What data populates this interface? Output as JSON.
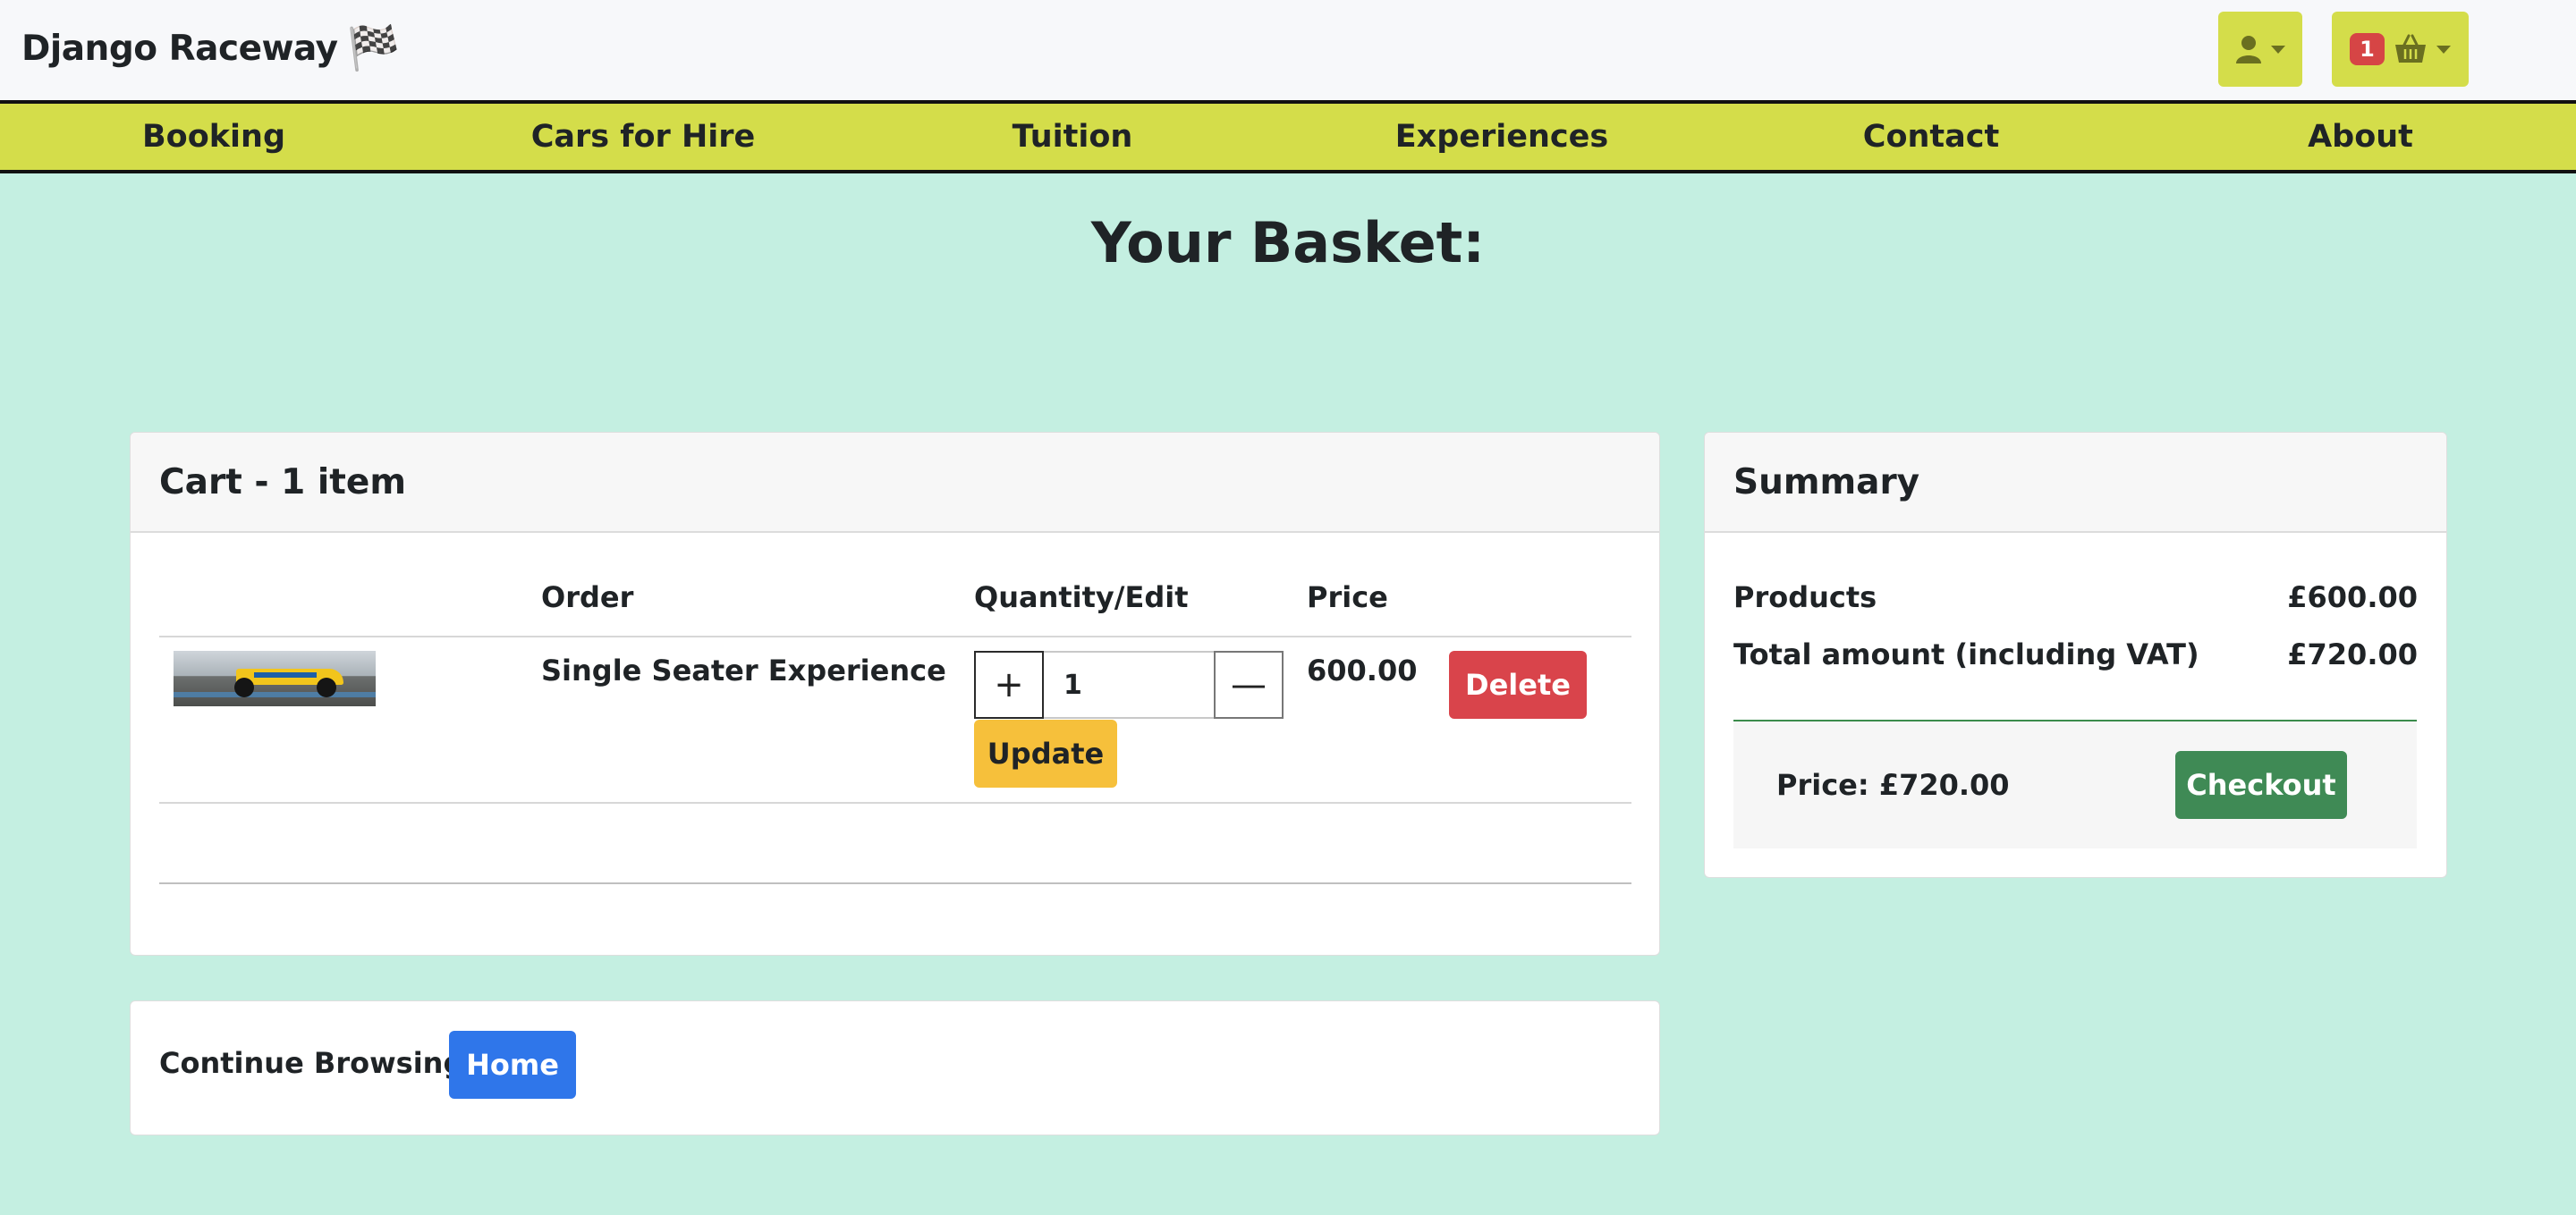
{
  "brand": {
    "name": "Django Raceway",
    "flag_icon": "🏁"
  },
  "header": {
    "user_icon": "user-icon",
    "basket_count": "1",
    "basket_icon": "basket-icon"
  },
  "nav": {
    "items": [
      {
        "label": "Booking"
      },
      {
        "label": "Cars for Hire"
      },
      {
        "label": "Tuition"
      },
      {
        "label": "Experiences"
      },
      {
        "label": "Contact"
      },
      {
        "label": "About"
      }
    ]
  },
  "page": {
    "title": "Your Basket:"
  },
  "cart": {
    "header": "Cart - 1 item",
    "columns": {
      "order": "Order",
      "quantity": "Quantity/Edit",
      "price": "Price"
    },
    "items": [
      {
        "image_icon": "racing-car-image",
        "name": "Single Seater Experience",
        "quantity": "1",
        "price": "600.00",
        "plus": "+",
        "minus": "—",
        "update_label": "Update",
        "delete_label": "Delete"
      }
    ]
  },
  "summary": {
    "header": "Summary",
    "products_label": "Products",
    "products_value": "£600.00",
    "total_label": "Total amount (including VAT)",
    "total_value": "£720.00",
    "price_text": "Price: £720.00",
    "checkout_label": "Checkout"
  },
  "browse": {
    "label": "Continue Browsing:",
    "home_label": "Home"
  },
  "colors": {
    "background": "#c4efe1",
    "nav": "#d4dd4a",
    "delete": "#d9444b",
    "update": "#f6c03b",
    "checkout": "#3f8a55",
    "home": "#2f76ea",
    "badge": "#d64545"
  }
}
